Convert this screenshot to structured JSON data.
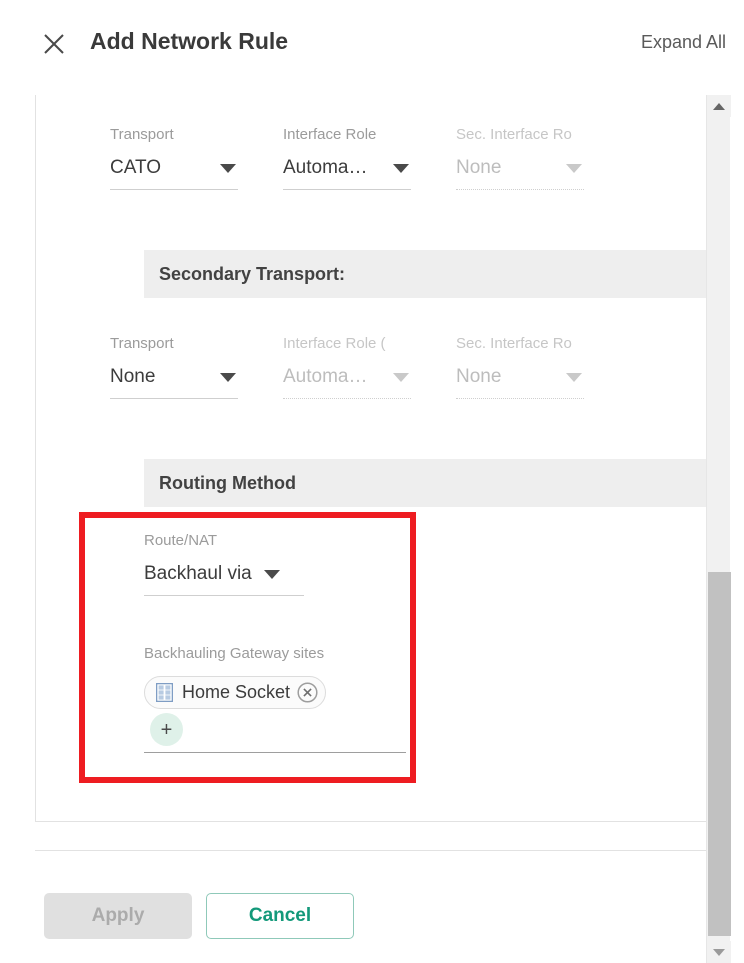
{
  "header": {
    "title": "Add Network Rule",
    "close_icon": "close-icon",
    "expand_all_label": "Expand All"
  },
  "colors": {
    "accent_green": "#13997a",
    "annotation_red": "#ee1c21",
    "section_header_bg": "#eeeeee",
    "chip_icon_blue": "#7f9dc4",
    "add_button_bg": "#dff1e9",
    "disabled_text": "#bdbdbd"
  },
  "primary_transport_row": {
    "fields": [
      {
        "label": "Transport",
        "value": "CATO",
        "disabled": false,
        "icon": "chevron-down-icon"
      },
      {
        "label": "Interface Role",
        "value": "Automa…",
        "disabled": false,
        "icon": "chevron-down-icon"
      },
      {
        "label": "Sec. Interface Ro",
        "value": "None",
        "disabled": true,
        "icon": "chevron-down-icon"
      }
    ]
  },
  "secondary_transport_section": {
    "header": "Secondary Transport:",
    "fields": [
      {
        "label": "Transport",
        "value": "None",
        "disabled": false,
        "icon": "chevron-down-icon"
      },
      {
        "label": "Interface Role  (",
        "value": "Automa…",
        "disabled": true,
        "icon": "chevron-down-icon"
      },
      {
        "label": "Sec. Interface Ro",
        "value": "None",
        "disabled": true,
        "icon": "chevron-down-icon"
      }
    ]
  },
  "routing_method_section": {
    "header": "Routing Method",
    "route_nat": {
      "label": "Route/NAT",
      "value": "Backhaul via",
      "icon": "chevron-down-icon"
    },
    "backhauling_gateway_sites": {
      "label": "Backhauling Gateway sites",
      "chips": [
        {
          "text": "Home Socket",
          "icon": "socket-grid-icon",
          "remove_icon": "remove-circle-icon"
        }
      ],
      "add_button_label": "+"
    }
  },
  "footer": {
    "apply_label": "Apply",
    "apply_disabled": true,
    "cancel_label": "Cancel"
  },
  "scrollbar": {
    "up_icon": "scroll-up-arrow-icon",
    "down_icon": "scroll-down-arrow-icon"
  }
}
